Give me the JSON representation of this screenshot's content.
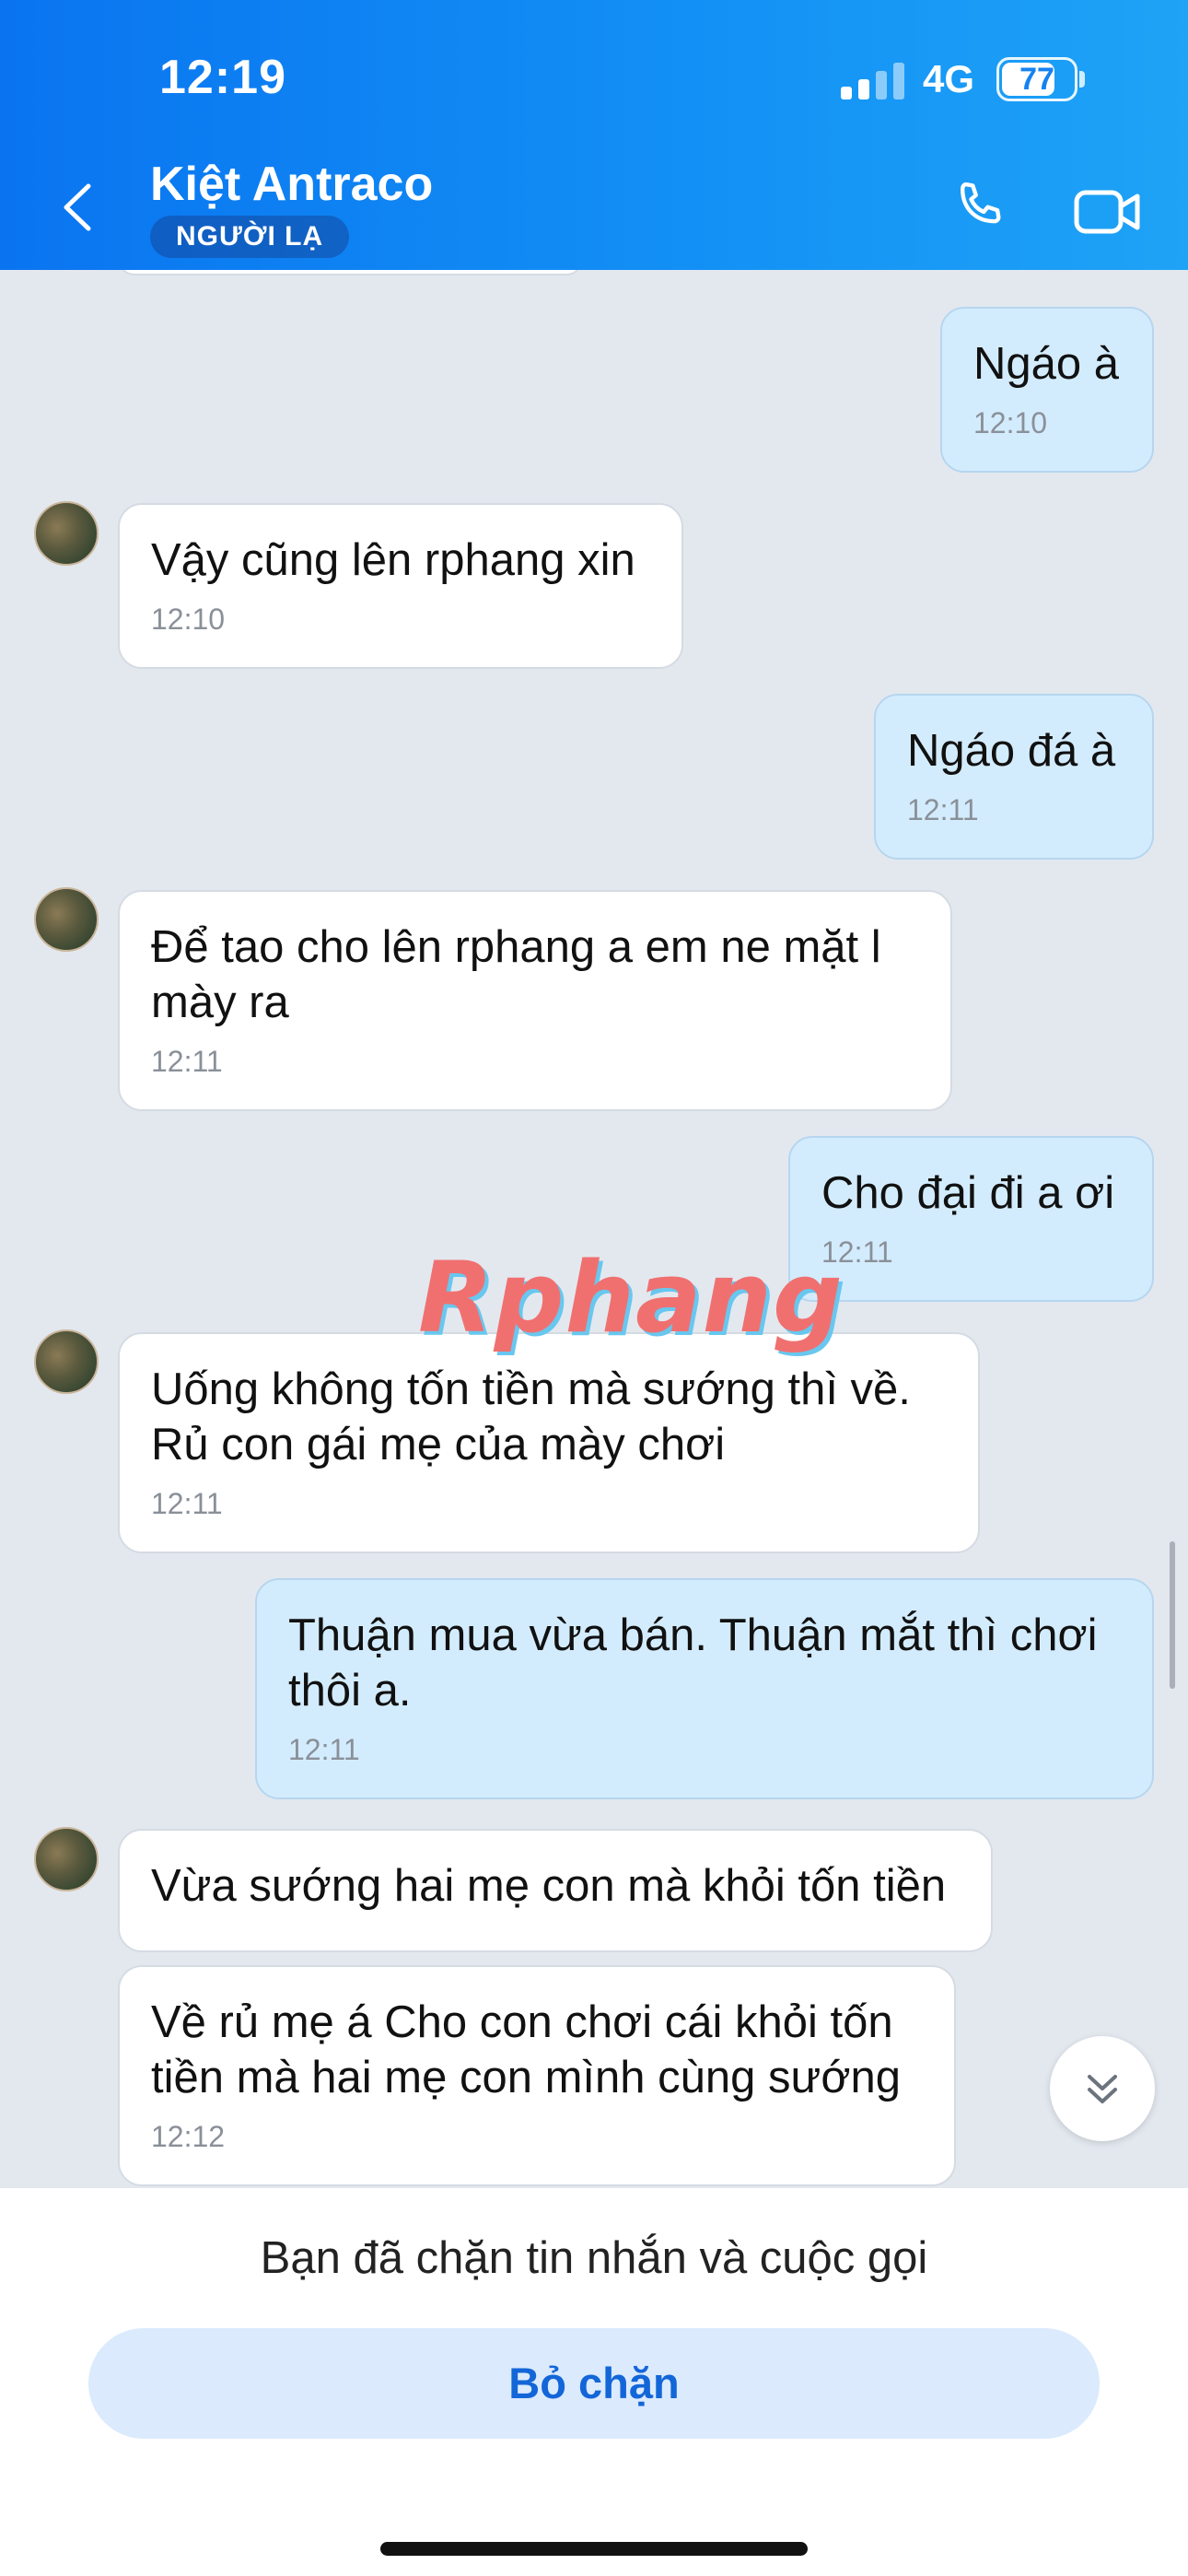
{
  "status_bar": {
    "time": "12:19",
    "network": "4G",
    "battery": "77",
    "battery_level": 0.77
  },
  "header": {
    "contact_name": "Kiệt Antraco",
    "badge": "NGƯỜI LẠ"
  },
  "icons": {
    "back": "chevron-left-icon",
    "call": "phone-icon",
    "video": "video-camera-icon",
    "scroll_down": "double-chevron-down-icon"
  },
  "messages": [
    {
      "from": "me",
      "text": "Ngáo à",
      "time": "12:10"
    },
    {
      "from": "contact",
      "text": "Vậy cũng lên rphang xin",
      "time": "12:10"
    },
    {
      "from": "me",
      "text": "Ngáo đá à",
      "time": "12:11"
    },
    {
      "from": "contact",
      "text": "Để tao cho lên rphang a em ne mặt l mày ra",
      "time": "12:11"
    },
    {
      "from": "me",
      "text": "Cho đại đi a ơi",
      "time": "12:11"
    },
    {
      "from": "contact",
      "text": "Uống không tốn tiền mà sướng thì về. Rủ con gái mẹ của mày chơi",
      "time": "12:11"
    },
    {
      "from": "me",
      "text": "Thuận mua vừa bán. Thuận mắt thì chơi thôi a.",
      "time": "12:11"
    },
    {
      "from": "contact",
      "text": "Vừa sướng hai mẹ con mà khỏi tốn tiền",
      "time": ""
    },
    {
      "from": "contact",
      "text": "Về rủ mẹ á Cho con chơi cái khỏi tốn tiền mà hai mẹ con mình cùng sướng",
      "time": "12:12"
    }
  ],
  "watermark": "Rphang",
  "footer": {
    "blocked_notice": "Bạn đã chặn tin nhắn và cuộc gọi",
    "unblock_label": "Bỏ chặn"
  },
  "colors": {
    "header_start": "#0a74f0",
    "header_end": "#1ea3f6",
    "chat_bg": "#e3e8ef",
    "outgoing_bubble": "#d3ecfd",
    "incoming_bubble": "#ffffff",
    "accent": "#1366d8"
  }
}
